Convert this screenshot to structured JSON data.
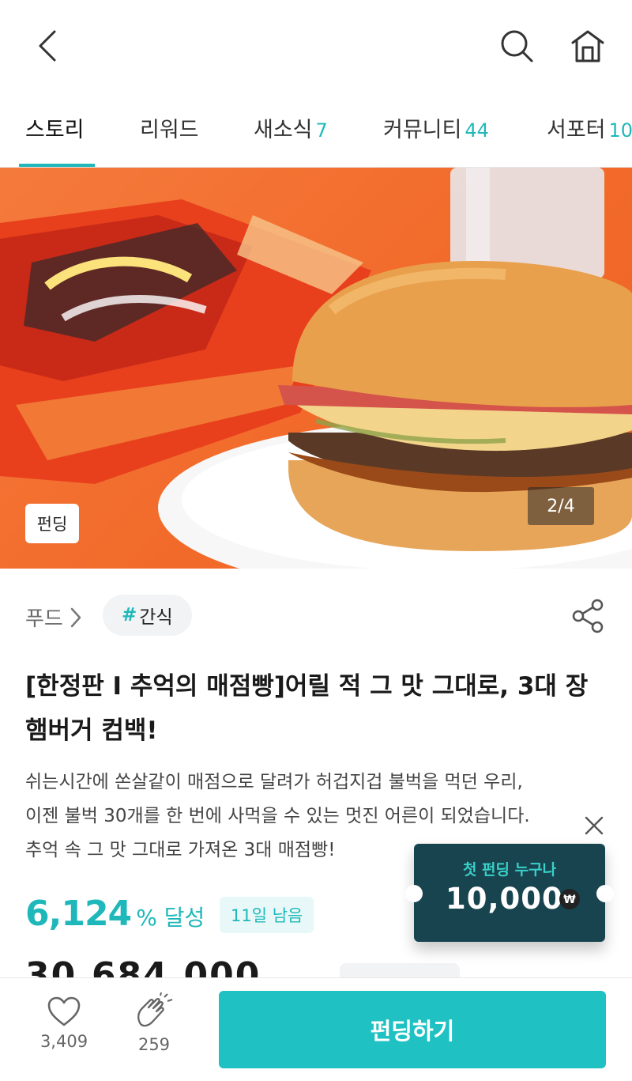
{
  "header": {
    "back_icon": "chevron-left-icon",
    "search_icon": "search-icon",
    "home_icon": "home-icon"
  },
  "tabs": [
    {
      "label": "스토리",
      "count": ""
    },
    {
      "label": "리워드",
      "count": ""
    },
    {
      "label": "새소식",
      "count": "7"
    },
    {
      "label": "커뮤니티",
      "count": "44"
    },
    {
      "label": "서포터",
      "count": "10"
    }
  ],
  "hero": {
    "badge": "펀딩",
    "pager": "2/4"
  },
  "meta": {
    "category": "푸드",
    "tag": "간식",
    "tag_hash": "#"
  },
  "project": {
    "title": "[한정판 I 추억의 매점빵]어릴 적 그 맛 그대로, 3대 장 햄버거 컴백!",
    "description_lines": [
      "쉬는시간에 쏜살같이 매점으로 달려가 허겁지겁 불벅을 먹던 우리,",
      "이젠 불벅 30개를 한 번에 사먹을 수 있는 멋진 어른이 되었습니다.",
      "추억 속 그 맛 그대로 가져온 3대 매점빵!"
    ],
    "percent": "6,124",
    "percent_unit": "% 달성",
    "days_left": "11일 남음",
    "amount_partial": "30,684,000"
  },
  "coupon": {
    "label": "첫 펀딩 누구나",
    "amount": "10,000",
    "currency_symbol": "₩"
  },
  "bottom": {
    "like_count": "3,409",
    "cheer_count": "259",
    "fund_button": "펀딩하기"
  },
  "colors": {
    "accent": "#1fb8ba",
    "button": "#1fc1c3",
    "coupon_bg": "#17444f",
    "hero_bg": "#f26a2a"
  }
}
